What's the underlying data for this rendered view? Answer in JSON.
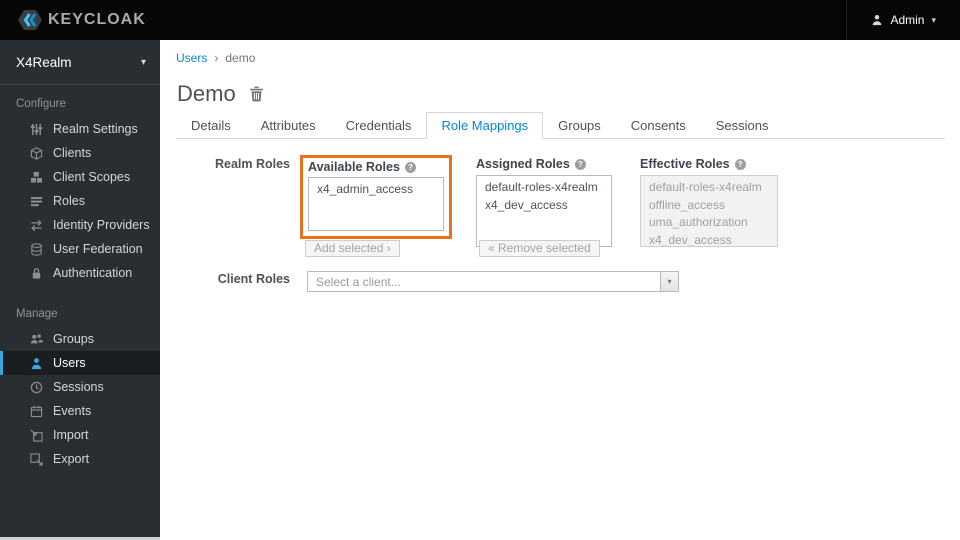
{
  "topbar": {
    "brand": "KEYCLOAK",
    "user": {
      "label": "Admin"
    }
  },
  "glyphs": {
    "caret_down": "▾",
    "help": "?",
    "breadcrumb_separator": "›"
  },
  "sidebar": {
    "realm": {
      "label": "X4Realm"
    },
    "sections": [
      {
        "label": "Configure",
        "items": [
          {
            "icon": "sliders-icon",
            "label": "Realm Settings"
          },
          {
            "icon": "cube-icon",
            "label": "Clients"
          },
          {
            "icon": "cubes-icon",
            "label": "Client Scopes"
          },
          {
            "icon": "list-icon",
            "label": "Roles"
          },
          {
            "icon": "arrows-icon",
            "label": "Identity Providers"
          },
          {
            "icon": "database-icon",
            "label": "User Federation"
          },
          {
            "icon": "lock-icon",
            "label": "Authentication"
          }
        ]
      },
      {
        "label": "Manage",
        "items": [
          {
            "icon": "group-icon",
            "label": "Groups"
          },
          {
            "icon": "user-icon",
            "label": "Users",
            "active": true
          },
          {
            "icon": "clock-icon",
            "label": "Sessions"
          },
          {
            "icon": "calendar-icon",
            "label": "Events"
          },
          {
            "icon": "import-icon",
            "label": "Import"
          },
          {
            "icon": "export-icon",
            "label": "Export"
          }
        ]
      }
    ]
  },
  "breadcrumb": {
    "items": [
      {
        "label": "Users"
      },
      {
        "label": "demo"
      }
    ]
  },
  "page": {
    "title": "Demo"
  },
  "tabs": {
    "items": [
      "Details",
      "Attributes",
      "Credentials",
      "Role Mappings",
      "Groups",
      "Consents",
      "Sessions"
    ],
    "active": "Role Mappings"
  },
  "realm_roles": {
    "label": "Realm Roles",
    "available": {
      "label": "Available Roles",
      "items": [
        "x4_admin_access"
      ],
      "button": "Add selected ›"
    },
    "assigned": {
      "label": "Assigned Roles",
      "items": [
        "default-roles-x4realm",
        "x4_dev_access"
      ],
      "button": "« Remove selected"
    },
    "effective": {
      "label": "Effective Roles",
      "items": [
        "default-roles-x4realm",
        "offline_access",
        "uma_authorization",
        "x4_dev_access"
      ]
    }
  },
  "client_roles": {
    "label": "Client Roles",
    "placeholder": "Select a client..."
  },
  "colors": {
    "accent_blue": "#0088ce",
    "nav_active_blue": "#39a5dc",
    "highlight_orange": "#e8731a",
    "topbar_bg": "#060606",
    "sidebar_bg": "#292e33"
  }
}
